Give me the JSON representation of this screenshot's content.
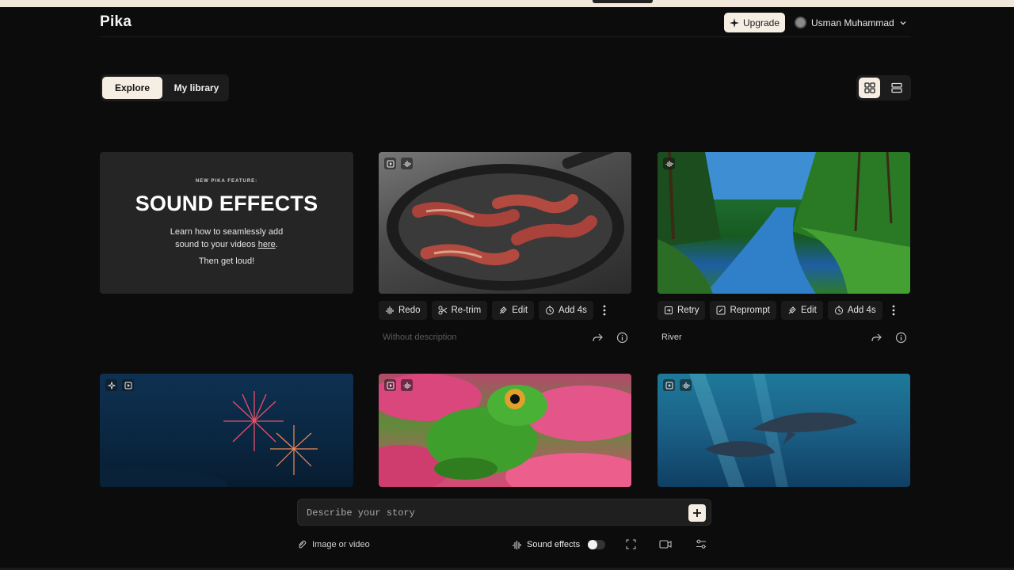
{
  "header": {
    "logo": "Pika",
    "upgrade_label": "Upgrade",
    "user_name": "Usman Muhammad"
  },
  "tabs": [
    {
      "label": "Explore",
      "active": true
    },
    {
      "label": "My library",
      "active": false
    }
  ],
  "view_toggle": {
    "selected": "grid"
  },
  "promo": {
    "kicker": "NEW PIKA FEATURE:",
    "title": "SOUND EFFECTS",
    "line1": "Learn how to seamlessly add",
    "line2_pre": "sound to your videos ",
    "line2_link": "here",
    "line2_post": ".",
    "line3": "Then get loud!"
  },
  "cards": [
    {
      "scene_icons": [
        "video-icon",
        "sound-wave-icon"
      ],
      "actions": [
        "Redo",
        "Re-trim",
        "Edit",
        "Add 4s"
      ],
      "description": "Without description",
      "description_placeholder": true
    },
    {
      "scene_icons": [
        "sound-wave-icon"
      ],
      "actions": [
        "Retry",
        "Reprompt",
        "Edit",
        "Add 4s"
      ],
      "description": "River",
      "description_placeholder": false
    },
    {
      "scene_icons": [
        "sparkle-icon",
        "video-icon"
      ]
    },
    {
      "scene_icons": [
        "video-icon",
        "sound-wave-icon"
      ]
    },
    {
      "scene_icons": [
        "video-icon",
        "sound-wave-icon"
      ]
    }
  ],
  "composer": {
    "placeholder": "Describe your story",
    "attach_label": "Image or video",
    "sound_effects_label": "Sound effects",
    "sound_effects_on": false
  },
  "colors": {
    "background": "#0c0c0c",
    "accent": "#f6eee3",
    "surface": "#1c1c1c"
  }
}
